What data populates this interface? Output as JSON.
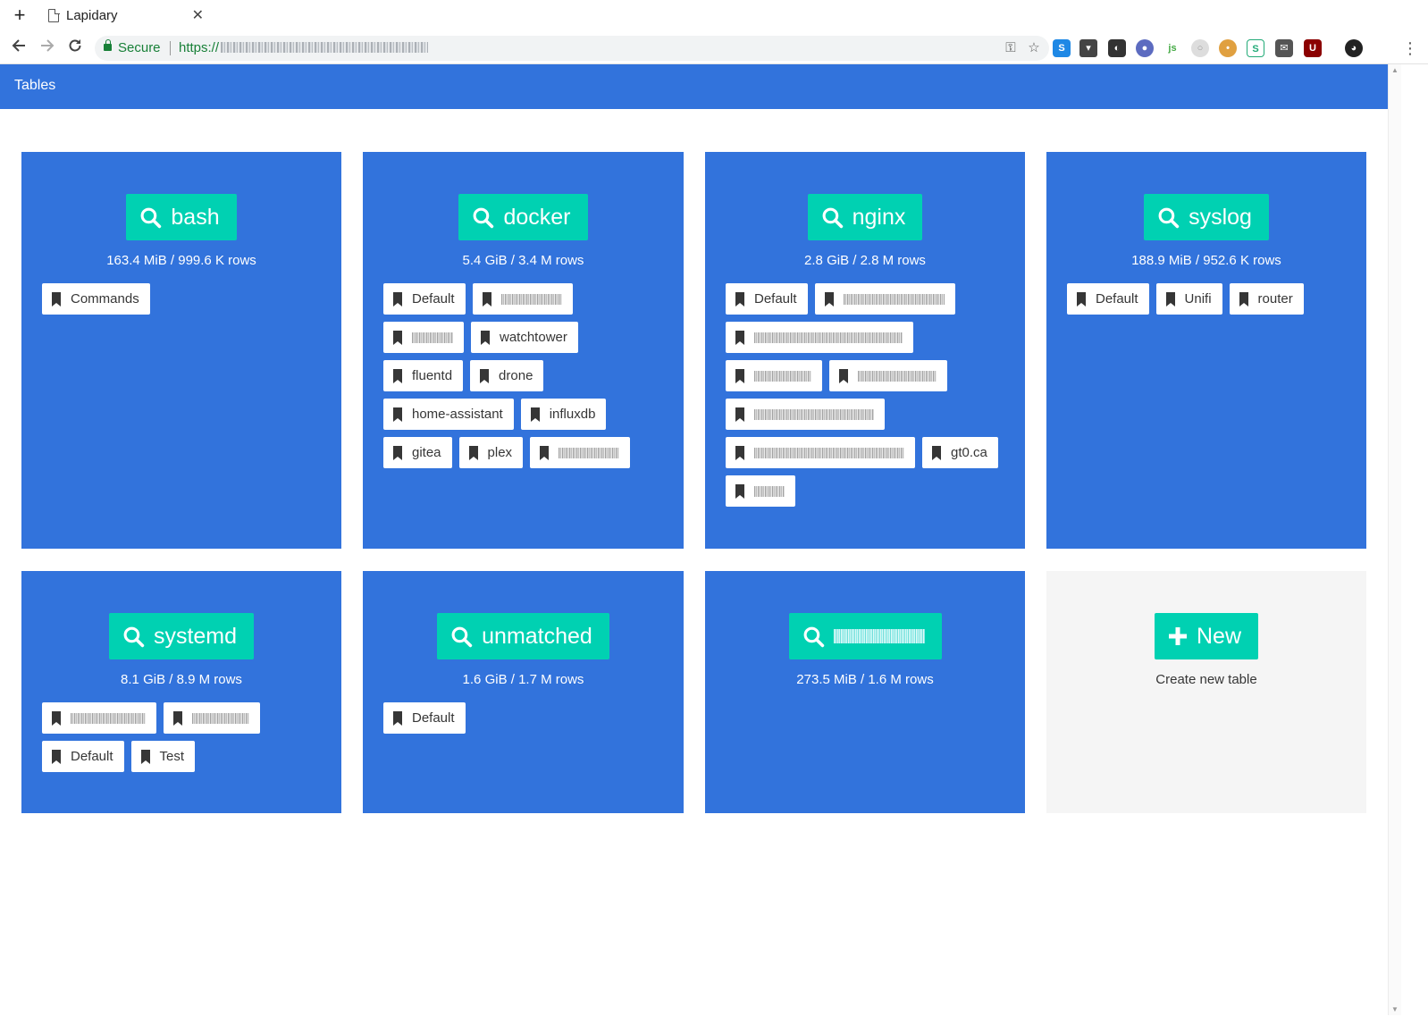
{
  "browser": {
    "tab_title": "Lapidary",
    "secure_label": "Secure",
    "url_prefix": "https://"
  },
  "app": {
    "title": "Tables"
  },
  "tables": [
    {
      "name": "bash",
      "stats": "163.4 MiB / 999.6 K rows",
      "views": [
        {
          "label": "Commands"
        }
      ]
    },
    {
      "name": "docker",
      "stats": "5.4 GiB / 3.4 M rows",
      "views": [
        {
          "label": "Default"
        },
        {
          "label": "",
          "redacted": true
        },
        {
          "label": "",
          "redacted": true
        },
        {
          "label": "watchtower"
        },
        {
          "label": "fluentd"
        },
        {
          "label": "drone"
        },
        {
          "label": "home-assistant"
        },
        {
          "label": "influxdb"
        },
        {
          "label": "gitea"
        },
        {
          "label": "plex"
        },
        {
          "label": "",
          "redacted": true
        }
      ]
    },
    {
      "name": "nginx",
      "stats": "2.8 GiB / 2.8 M rows",
      "views": [
        {
          "label": "Default"
        },
        {
          "label": "",
          "redacted": true
        },
        {
          "label": "",
          "redacted": true
        },
        {
          "label": "",
          "redacted": true
        },
        {
          "label": "",
          "redacted": true
        },
        {
          "label": "",
          "redacted": true
        },
        {
          "label": "",
          "redacted": true
        },
        {
          "label": "gt0.ca"
        },
        {
          "label": "",
          "redacted": true
        }
      ]
    },
    {
      "name": "syslog",
      "stats": "188.9 MiB / 952.6 K rows",
      "views": [
        {
          "label": "Default"
        },
        {
          "label": "Unifi"
        },
        {
          "label": "router"
        }
      ]
    },
    {
      "name": "systemd",
      "stats": "8.1 GiB / 8.9 M rows",
      "views": [
        {
          "label": "",
          "redacted": true
        },
        {
          "label": "",
          "redacted": true
        },
        {
          "label": "Default"
        },
        {
          "label": "Test"
        }
      ]
    },
    {
      "name": "unmatched",
      "stats": "1.6 GiB / 1.7 M rows",
      "views": [
        {
          "label": "Default"
        }
      ]
    },
    {
      "name": "",
      "name_redacted": true,
      "stats": "273.5 MiB / 1.6 M rows",
      "views": []
    }
  ],
  "new_table": {
    "button_label": "New",
    "caption": "Create new table"
  },
  "colors": {
    "primary": "#3273dc",
    "accent": "#00d1b2",
    "secure_green": "#188038"
  }
}
